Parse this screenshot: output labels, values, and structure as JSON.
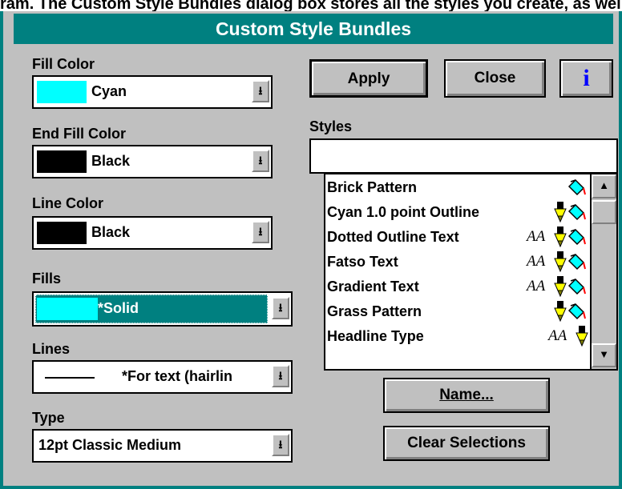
{
  "background_text": "ram. The Custom Style Bundles dialog box stores all the styles you create, as well as those su",
  "window": {
    "title": "Custom Style Bundles"
  },
  "fill_color": {
    "label": "Fill Color",
    "value": "Cyan",
    "swatch": "#00ffff"
  },
  "end_fill_color": {
    "label": "End Fill Color",
    "value": "Black",
    "swatch": "#000000"
  },
  "line_color": {
    "label": "Line Color",
    "value": "Black",
    "swatch": "#000000"
  },
  "fills": {
    "label": "Fills",
    "value": "*Solid",
    "swatch": "#00ffff",
    "highlight": "#008080"
  },
  "lines": {
    "label": "Lines",
    "value": "*For text (hairlin"
  },
  "type": {
    "label": "Type",
    "value": "12pt Classic Medium"
  },
  "buttons": {
    "apply": "Apply",
    "close": "Close",
    "info": "i",
    "name": "Name...",
    "clear": "Clear Selections"
  },
  "styles": {
    "label": "Styles",
    "input_value": "",
    "items": [
      {
        "name": "Brick Pattern",
        "icons": [
          "bucket"
        ]
      },
      {
        "name": "Cyan 1.0 point Outline",
        "icons": [
          "pen",
          "bucket"
        ]
      },
      {
        "name": "Dotted Outline Text",
        "icons": [
          "type",
          "pen",
          "bucket"
        ]
      },
      {
        "name": "Fatso Text",
        "icons": [
          "type",
          "pen",
          "bucket"
        ]
      },
      {
        "name": "Gradient Text",
        "icons": [
          "type",
          "pen",
          "bucket"
        ]
      },
      {
        "name": "Grass Pattern",
        "icons": [
          "pen",
          "bucket"
        ]
      },
      {
        "name": "Headline Type",
        "icons": [
          "type",
          "pen"
        ]
      }
    ]
  }
}
